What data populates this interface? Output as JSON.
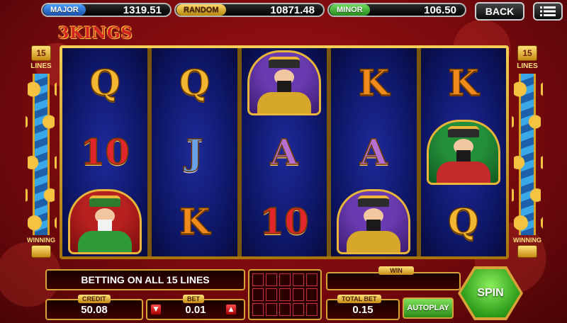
{
  "jackpots": {
    "major": {
      "label": "MAJOR",
      "value": "1319.51",
      "color": "#1f6fd1"
    },
    "random": {
      "label": "RANDOM",
      "value": "10871.48",
      "color": "#e0a92a"
    },
    "minor": {
      "label": "MINOR",
      "value": "106.50",
      "color": "#3bb33b"
    }
  },
  "nav": {
    "back_label": "BACK",
    "menu_icon": "hamburger-menu-icon"
  },
  "logo": {
    "text": "3KINGS"
  },
  "lines": {
    "count": "15",
    "label": "LINES",
    "winning_label": "WINNING"
  },
  "reels": [
    [
      "Q",
      "10",
      "king-white"
    ],
    [
      "Q",
      "J",
      "K"
    ],
    [
      "king-yellow",
      "A",
      "10"
    ],
    [
      "K",
      "A",
      "king-yellow"
    ],
    [
      "K",
      "king-red",
      "Q"
    ]
  ],
  "bottom": {
    "bet_message": "BETTING ON ALL 15 LINES",
    "win_label": "WIN",
    "win_value": "",
    "credit_label": "CREDIT",
    "credit_value": "50.08",
    "bet_label": "BET",
    "bet_value": "0.01",
    "total_bet_label": "TOTAL BET",
    "total_bet_value": "0.15",
    "autoplay_label": "AUTOPLAY",
    "spin_label": "SPIN"
  }
}
